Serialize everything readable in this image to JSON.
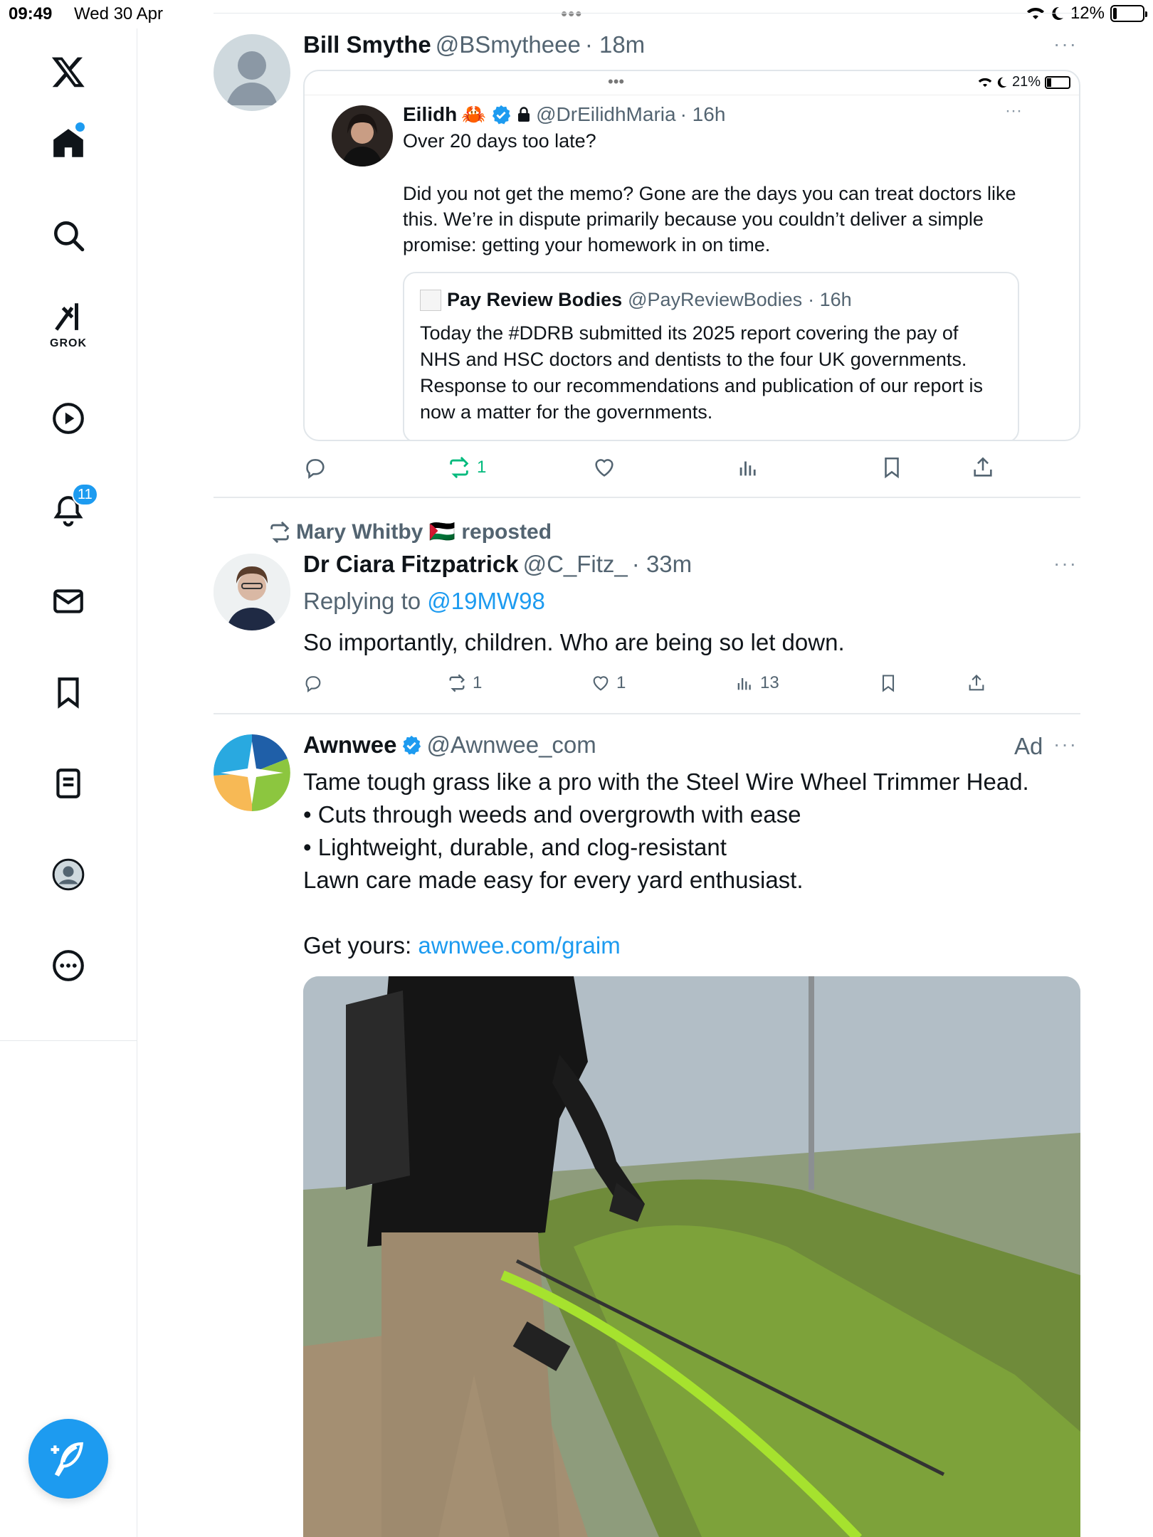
{
  "status_bar": {
    "time": "09:49",
    "date": "Wed 30 Apr",
    "battery": "12%",
    "battery_level": 0.12,
    "center_dots": "•••"
  },
  "sidebar": {
    "items": [
      {
        "name": "x-logo",
        "label": ""
      },
      {
        "name": "home",
        "label": ""
      },
      {
        "name": "search",
        "label": ""
      },
      {
        "name": "grok",
        "label": "GROK"
      },
      {
        "name": "video",
        "label": ""
      },
      {
        "name": "notifications",
        "label": "",
        "badge": "11"
      },
      {
        "name": "messages",
        "label": ""
      },
      {
        "name": "bookmarks",
        "label": ""
      },
      {
        "name": "lists",
        "label": ""
      },
      {
        "name": "profile",
        "label": ""
      },
      {
        "name": "more",
        "label": ""
      }
    ]
  },
  "tweet1": {
    "name": "Bill Smythe",
    "handle": "@BSmytheee",
    "time": "· 18m",
    "more": "···",
    "embed": {
      "battery": "21%",
      "dots": "•••",
      "author_name": "Eilidh",
      "author_emoji": "🦀",
      "handle": "@DrEilidhMaria",
      "time": "· 16h",
      "more": "···",
      "text_lines": [
        "Over 20 days too late?",
        "",
        "Did you not get the memo? Gone are the days you can treat doctors like",
        "this. We’re in dispute primarily because you couldn’t deliver a simple",
        "promise: getting your homework in on time."
      ],
      "quote": {
        "name": "Pay Review Bodies",
        "handle": "@PayReviewBodies",
        "time": "· 16h",
        "text_lines": [
          "Today the #DDRB submitted its 2025 report covering the pay of",
          "NHS and HSC doctors and dentists to the four UK governments.",
          "Response to our recommendations and publication of our report is",
          "now a matter for the governments."
        ]
      }
    },
    "actions": {
      "replies": "",
      "reposts": "1",
      "likes": "",
      "views": ""
    }
  },
  "tweet2": {
    "reposted_by": "Mary Whitby 🇵🇸 reposted",
    "name": "Dr Ciara Fitzpatrick",
    "handle": "@C_Fitz_",
    "time": "· 33m",
    "more": "···",
    "replying_prefix": "Replying to",
    "replying_to": "@19MW98",
    "text": "So importantly, children. Who are being so let down.",
    "actions": {
      "replies": "",
      "reposts": "1",
      "likes": "1",
      "views": "13"
    }
  },
  "tweet3": {
    "name": "Awnwee",
    "handle": "@Awnwee_com",
    "ad_label": "Ad",
    "more": "···",
    "text_lines": [
      "Tame tough grass like a pro with the Steel Wire Wheel Trimmer Head.",
      "• Cuts through weeds and overgrowth with ease",
      "• Lightweight, durable, and clog-resistant",
      "Lawn care made easy for every yard enthusiast."
    ],
    "cta_prefix": "Get yours:",
    "cta_link": "awnwee.com/graim"
  },
  "colors": {
    "accent": "#1d9bf0",
    "repost_green": "#00ba7c",
    "muted": "#536471",
    "border": "#e6e9ec"
  }
}
